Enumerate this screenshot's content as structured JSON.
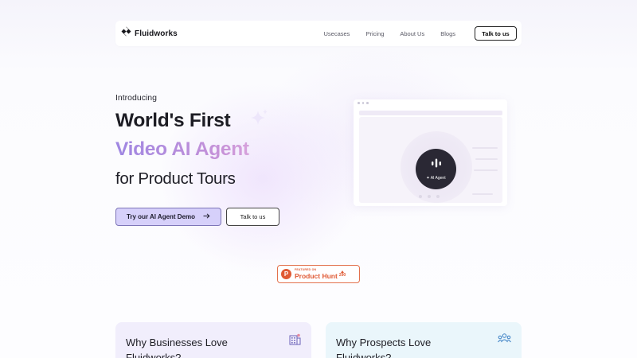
{
  "brand": {
    "name": "Fluidworks"
  },
  "nav": {
    "links": [
      "Usecases",
      "Pricing",
      "About Us",
      "Blogs"
    ],
    "cta": "Talk to us"
  },
  "hero": {
    "intro": "Introducing",
    "line1": "World's First",
    "line2": "Video AI Agent",
    "line3": "for Product Tours",
    "primary_cta": "Try our AI Agent Demo",
    "secondary_cta": "Talk to us"
  },
  "preview": {
    "agent_label": "✦ AI Agent"
  },
  "product_hunt": {
    "featured": "FEATURED ON",
    "name": "Product Hunt",
    "votes": "290"
  },
  "cards": [
    {
      "title_line1": "Why Businesses Love",
      "title_line2": "Fluidworks?"
    },
    {
      "title_line1": "Why Prospects Love",
      "title_line2": "Fluidworks?"
    }
  ],
  "colors": {
    "accent": "#d6d0fa",
    "gradient_start": "#9f87e2",
    "gradient_end": "#d7a2dc",
    "product_hunt": "#e05a34"
  }
}
